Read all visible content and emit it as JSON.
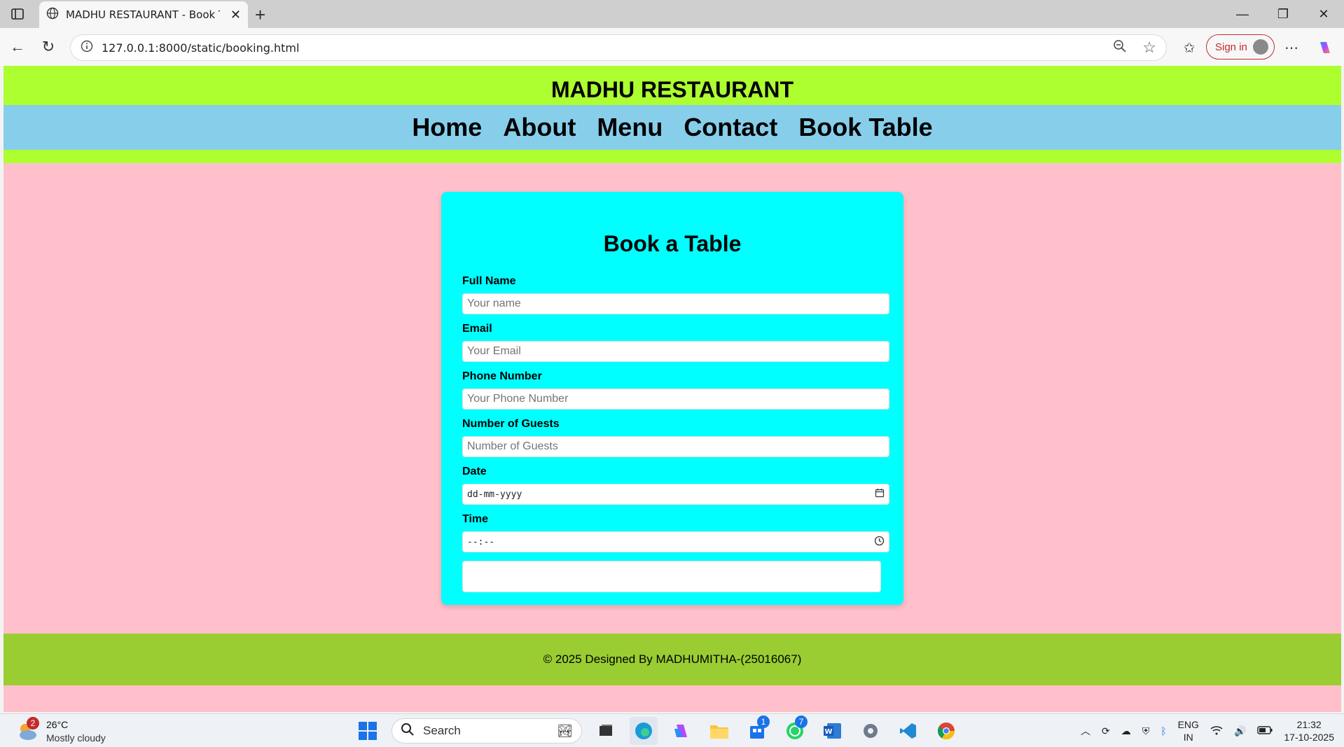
{
  "browser": {
    "tab_title": "MADHU RESTAURANT - Book Tab",
    "url": "127.0.0.1:8000/static/booking.html",
    "sign_in_label": "Sign in",
    "icons": [
      "sidebar-icon",
      "globe-icon",
      "close-icon",
      "plus-icon",
      "back-icon",
      "reload-icon",
      "info-icon",
      "zoom-out-icon",
      "star-icon",
      "favorites-icon",
      "more-icon",
      "copilot-icon"
    ]
  },
  "site": {
    "title": "MADHU RESTAURANT",
    "nav": [
      {
        "label": "Home"
      },
      {
        "label": "About"
      },
      {
        "label": "Menu"
      },
      {
        "label": "Contact"
      },
      {
        "label": "Book Table"
      }
    ],
    "colors": {
      "header": "#adff2f",
      "nav": "#87ceeb",
      "page_bg": "#ffc0cb",
      "card": "#00ffff",
      "footer": "#9acd32"
    }
  },
  "booking_form": {
    "title": "Book a Table",
    "fields": {
      "name": {
        "label": "Full Name",
        "placeholder": "Your name",
        "value": ""
      },
      "email": {
        "label": "Email",
        "placeholder": "Your Email",
        "value": ""
      },
      "phone": {
        "label": "Phone Number",
        "placeholder": "Your Phone Number",
        "value": ""
      },
      "guests": {
        "label": "Number of Guests",
        "placeholder": "Number of Guests",
        "value": ""
      },
      "date": {
        "label": "Date",
        "placeholder": "dd-mm-yyyy",
        "value": ""
      },
      "time": {
        "label": "Time",
        "placeholder": "--:--",
        "value": ""
      }
    },
    "submit_label": ""
  },
  "footer": {
    "text": "© 2025 Designed By MADHUMITHA-(25016067)"
  },
  "taskbar": {
    "weather_temp": "26°C",
    "weather_condition": "Mostly cloudy",
    "weather_badge": "2",
    "search_label": "Search",
    "store_badge": "1",
    "whatsapp_badge": "7",
    "language_line1": "ENG",
    "language_line2": "IN",
    "time": "21:32",
    "date": "17-10-2025"
  }
}
